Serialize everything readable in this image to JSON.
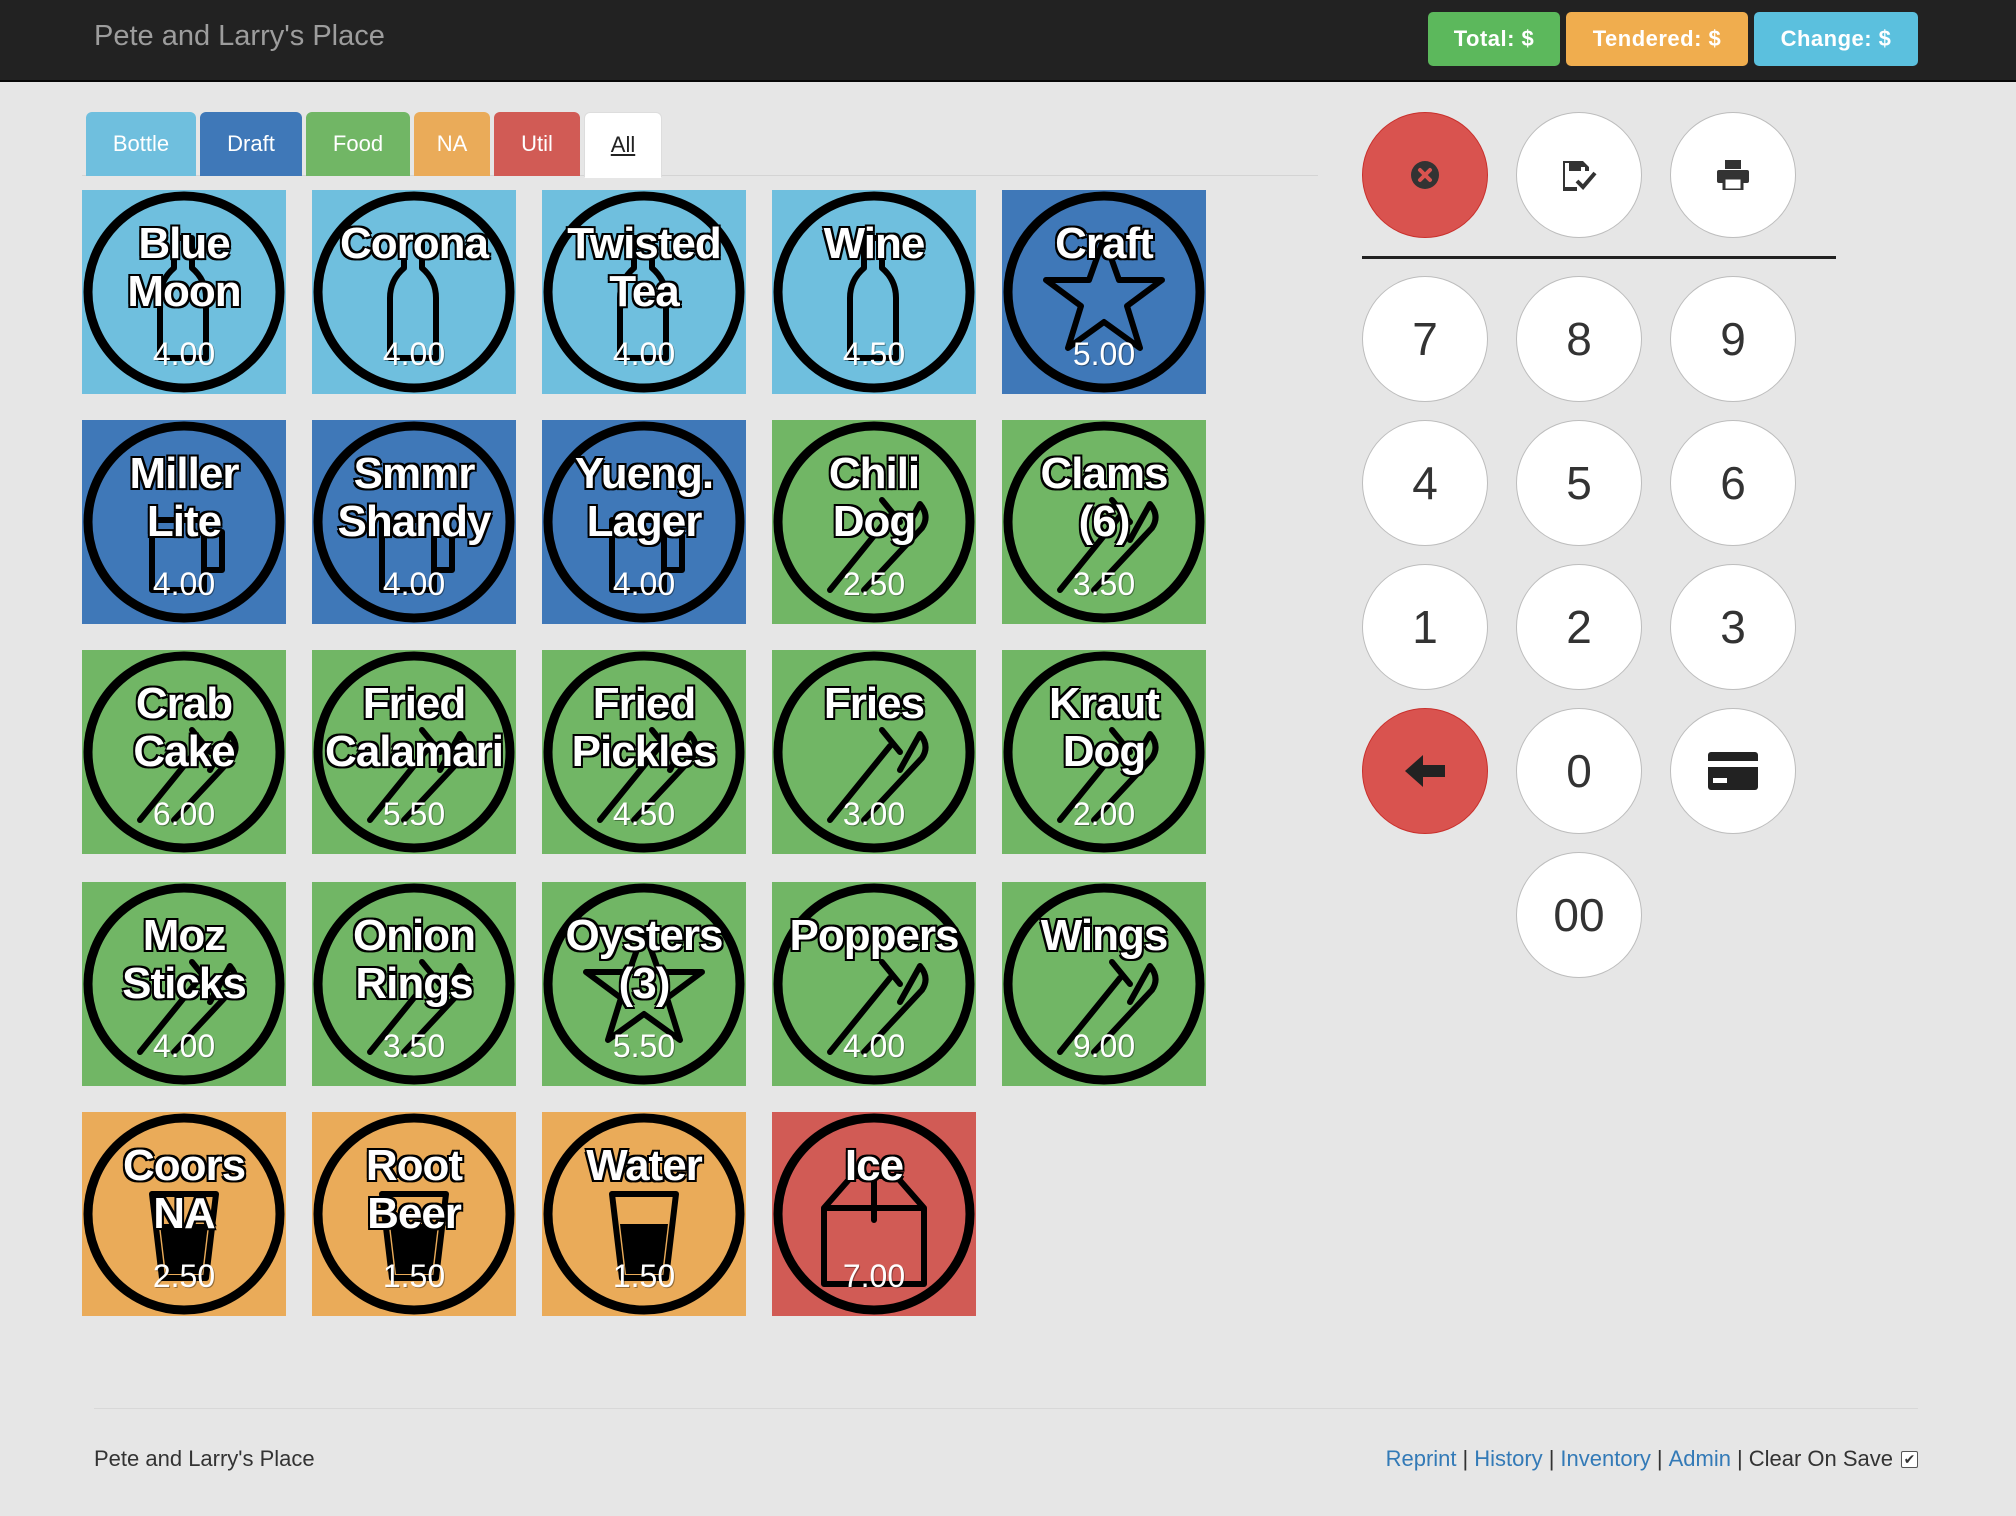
{
  "navbar": {
    "brand": "Pete and Larry's Place",
    "total_label": "Total: $",
    "tendered_label": "Tendered: $",
    "change_label": "Change: $"
  },
  "tabs": [
    {
      "label": "Bottle",
      "color": "#6fbfde"
    },
    {
      "label": "Draft",
      "color": "#3f78b8"
    },
    {
      "label": "Food",
      "color": "#71b665"
    },
    {
      "label": "NA",
      "color": "#eaab59"
    },
    {
      "label": "Util",
      "color": "#d15b55"
    },
    {
      "label": "All",
      "color": "#ffffff",
      "active": true
    }
  ],
  "colors": {
    "bottle": "#6fbfde",
    "draft": "#3f78b8",
    "food": "#71b665",
    "na": "#eaab59",
    "util": "#d15b55"
  },
  "products": [
    {
      "name": "Blue\nMoon",
      "price": "4.00",
      "category": "bottle",
      "icon": "bottle-icon"
    },
    {
      "name": "Corona",
      "price": "4.00",
      "category": "bottle",
      "icon": "bottle-icon"
    },
    {
      "name": "Twisted\nTea",
      "price": "4.00",
      "category": "bottle",
      "icon": "bottle-icon"
    },
    {
      "name": "Wine",
      "price": "4.50",
      "category": "bottle",
      "icon": "bottle-icon"
    },
    {
      "name": "Craft",
      "price": "5.00",
      "category": "draft",
      "icon": "star-icon"
    },
    {
      "name": "Miller\nLite",
      "price": "4.00",
      "category": "draft",
      "icon": "mug-icon"
    },
    {
      "name": "Smmr\nShandy",
      "price": "4.00",
      "category": "draft",
      "icon": "mug-icon"
    },
    {
      "name": "Yueng.\nLager",
      "price": "4.00",
      "category": "draft",
      "icon": "mug-icon"
    },
    {
      "name": "Chili\nDog",
      "price": "2.50",
      "category": "food",
      "icon": "cutlery-icon"
    },
    {
      "name": "Clams\n(6)",
      "price": "3.50",
      "category": "food",
      "icon": "cutlery-icon"
    },
    {
      "name": "Crab\nCake",
      "price": "6.00",
      "category": "food",
      "icon": "cutlery-icon"
    },
    {
      "name": "Fried\nCalamari",
      "price": "5.50",
      "category": "food",
      "icon": "cutlery-icon"
    },
    {
      "name": "Fried\nPickles",
      "price": "4.50",
      "category": "food",
      "icon": "cutlery-icon"
    },
    {
      "name": "Fries",
      "price": "3.00",
      "category": "food",
      "icon": "cutlery-icon"
    },
    {
      "name": "Kraut\nDog",
      "price": "2.00",
      "category": "food",
      "icon": "cutlery-icon"
    },
    {
      "name": "Moz\nSticks",
      "price": "4.00",
      "category": "food",
      "icon": "cutlery-icon"
    },
    {
      "name": "Onion\nRings",
      "price": "3.50",
      "category": "food",
      "icon": "cutlery-icon"
    },
    {
      "name": "Oysters\n(3)",
      "price": "5.50",
      "category": "food",
      "icon": "star-icon"
    },
    {
      "name": "Poppers",
      "price": "4.00",
      "category": "food",
      "icon": "cutlery-icon"
    },
    {
      "name": "Wings",
      "price": "9.00",
      "category": "food",
      "icon": "cutlery-icon"
    },
    {
      "name": "Coors\nNA",
      "price": "2.50",
      "category": "na",
      "icon": "glass-icon"
    },
    {
      "name": "Root\nBeer",
      "price": "1.50",
      "category": "na",
      "icon": "glass-icon"
    },
    {
      "name": "Water",
      "price": "1.50",
      "category": "na",
      "icon": "glass-icon"
    },
    {
      "name": "Ice",
      "price": "7.00",
      "category": "util",
      "icon": "box-icon"
    }
  ],
  "actions": [
    {
      "name": "cancel-button",
      "icon": "remove-circle-icon"
    },
    {
      "name": "save-button",
      "icon": "floppy-saved-icon"
    },
    {
      "name": "print-button",
      "icon": "print-icon"
    }
  ],
  "keypad": [
    "7",
    "8",
    "9",
    "4",
    "5",
    "6",
    "1",
    "2",
    "3",
    "",
    "0",
    "",
    "00"
  ],
  "footer": {
    "brand": "Pete and Larry's Place",
    "links": [
      "Reprint",
      "History",
      "Inventory",
      "Admin"
    ],
    "separator": "|",
    "clear_on_save_label": "Clear On Save",
    "clear_on_save_checked": true
  }
}
